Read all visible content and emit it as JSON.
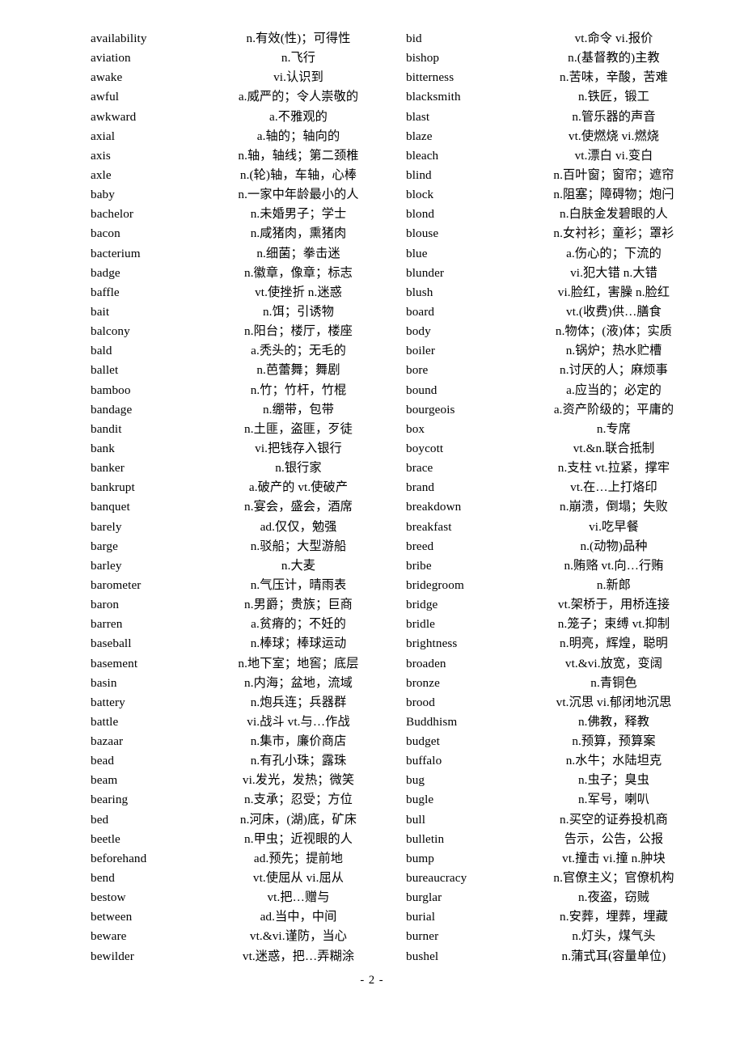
{
  "page": {
    "footer_label": "- 2 -",
    "page_number": "2",
    "text_color": "#000000",
    "background_color": "#ffffff"
  },
  "columns": [
    {
      "name": "left-column",
      "entries": [
        {
          "term": "availability",
          "definition": "n.有效(性)；可得性"
        },
        {
          "term": "aviation",
          "definition": "n.飞行"
        },
        {
          "term": "awake",
          "definition": "vi.认识到"
        },
        {
          "term": "awful",
          "definition": "a.威严的；令人崇敬的"
        },
        {
          "term": "awkward",
          "definition": "a.不雅观的"
        },
        {
          "term": "axial",
          "definition": "a.轴的；轴向的"
        },
        {
          "term": "axis",
          "definition": "n.轴，轴线；第二颈椎"
        },
        {
          "term": "axle",
          "definition": "n.(轮)轴，车轴，心棒"
        },
        {
          "term": "baby",
          "definition": "n.一家中年龄最小的人"
        },
        {
          "term": "bachelor",
          "definition": "n.未婚男子；学士"
        },
        {
          "term": "bacon",
          "definition": "n.咸猪肉，熏猪肉"
        },
        {
          "term": "bacterium",
          "definition": "n.细菌；拳击迷"
        },
        {
          "term": "badge",
          "definition": "n.徽章，像章；标志"
        },
        {
          "term": "baffle",
          "definition": "vt.使挫折 n.迷惑"
        },
        {
          "term": "bait",
          "definition": "n.饵；引诱物"
        },
        {
          "term": "balcony",
          "definition": "n.阳台；楼厅，楼座"
        },
        {
          "term": "bald",
          "definition": "a.秃头的；无毛的"
        },
        {
          "term": "ballet",
          "definition": "n.芭蕾舞；舞剧"
        },
        {
          "term": "bamboo",
          "definition": "n.竹；竹杆，竹棍"
        },
        {
          "term": "bandage",
          "definition": "n.绷带，包带"
        },
        {
          "term": "bandit",
          "definition": "n.土匪，盗匪，歹徒"
        },
        {
          "term": "bank",
          "definition": "vi.把钱存入银行"
        },
        {
          "term": "banker",
          "definition": "n.银行家"
        },
        {
          "term": "bankrupt",
          "definition": "a.破产的 vt.使破产"
        },
        {
          "term": "banquet",
          "definition": "n.宴会，盛会，酒席"
        },
        {
          "term": "barely",
          "definition": "ad.仅仅，勉强"
        },
        {
          "term": "barge",
          "definition": "n.驳船；大型游船"
        },
        {
          "term": "barley",
          "definition": "n.大麦"
        },
        {
          "term": "barometer",
          "definition": "n.气压计，晴雨表"
        },
        {
          "term": "baron",
          "definition": "n.男爵；贵族；巨商"
        },
        {
          "term": "barren",
          "definition": "a.贫瘠的；不妊的"
        },
        {
          "term": "baseball",
          "definition": "n.棒球；棒球运动"
        },
        {
          "term": "basement",
          "definition": "n.地下室；地窖；底层"
        },
        {
          "term": "basin",
          "definition": "n.内海；盆地，流域"
        },
        {
          "term": "battery",
          "definition": "n.炮兵连；兵器群"
        },
        {
          "term": "battle",
          "definition": "vi.战斗 vt.与…作战"
        },
        {
          "term": "bazaar",
          "definition": "n.集市，廉价商店"
        },
        {
          "term": "bead",
          "definition": "n.有孔小珠；露珠"
        },
        {
          "term": "beam",
          "definition": "vi.发光，发热；微笑"
        },
        {
          "term": "bearing",
          "definition": "n.支承；忍受；方位"
        },
        {
          "term": "bed",
          "definition": "n.河床，(湖)底，矿床"
        },
        {
          "term": "beetle",
          "definition": "n.甲虫；近视眼的人"
        },
        {
          "term": "beforehand",
          "definition": "ad.预先；提前地"
        },
        {
          "term": "bend",
          "definition": "vt.使屈从 vi.屈从"
        },
        {
          "term": "bestow",
          "definition": "vt.把…赠与"
        },
        {
          "term": "between",
          "definition": "ad.当中，中间"
        },
        {
          "term": "beware",
          "definition": "vt.&vi.谨防，当心"
        },
        {
          "term": "bewilder",
          "definition": "vt.迷惑，把…弄糊涂"
        }
      ]
    },
    {
      "name": "right-column",
      "entries": [
        {
          "term": "bid",
          "definition": "vt.命令 vi.报价"
        },
        {
          "term": "bishop",
          "definition": "n.(基督教的)主教"
        },
        {
          "term": "bitterness",
          "definition": "n.苦味，辛酸，苦难"
        },
        {
          "term": "blacksmith",
          "definition": "n.铁匠，锻工"
        },
        {
          "term": "blast",
          "definition": "n.管乐器的声音"
        },
        {
          "term": "blaze",
          "definition": "vt.使燃烧 vi.燃烧"
        },
        {
          "term": "bleach",
          "definition": "vt.漂白 vi.变白"
        },
        {
          "term": "blind",
          "definition": "n.百叶窗；窗帘；遮帘"
        },
        {
          "term": "block",
          "definition": "n.阻塞；障碍物；炮闩"
        },
        {
          "term": "blond",
          "definition": "n.白肤金发碧眼的人"
        },
        {
          "term": "blouse",
          "definition": "n.女衬衫；童衫；罩衫"
        },
        {
          "term": "blue",
          "definition": "a.伤心的；下流的"
        },
        {
          "term": "blunder",
          "definition": "vi.犯大错 n.大错"
        },
        {
          "term": "blush",
          "definition": "vi.脸红，害臊 n.脸红"
        },
        {
          "term": "board",
          "definition": "vt.(收费)供…膳食"
        },
        {
          "term": "body",
          "definition": "n.物体；(液)体；实质"
        },
        {
          "term": "boiler",
          "definition": "n.锅炉；热水贮槽"
        },
        {
          "term": "bore",
          "definition": "n.讨厌的人；麻烦事"
        },
        {
          "term": "bound",
          "definition": "a.应当的；必定的"
        },
        {
          "term": "bourgeois",
          "definition": "a.资产阶级的；平庸的"
        },
        {
          "term": "box",
          "definition": "n.专席"
        },
        {
          "term": "boycott",
          "definition": "vt.&n.联合抵制"
        },
        {
          "term": "brace",
          "definition": "n.支柱 vt.拉紧，撑牢"
        },
        {
          "term": "brand",
          "definition": "vt.在…上打烙印"
        },
        {
          "term": "breakdown",
          "definition": "n.崩溃，倒塌；失败"
        },
        {
          "term": "breakfast",
          "definition": "vi.吃早餐"
        },
        {
          "term": "breed",
          "definition": "n.(动物)品种"
        },
        {
          "term": "bribe",
          "definition": "n.贿赂 vt.向…行贿"
        },
        {
          "term": "bridegroom",
          "definition": "n.新郎"
        },
        {
          "term": "bridge",
          "definition": "vt.架桥于，用桥连接"
        },
        {
          "term": "bridle",
          "definition": "n.笼子；束缚 vt.抑制"
        },
        {
          "term": "brightness",
          "definition": "n.明亮，辉煌，聪明"
        },
        {
          "term": "broaden",
          "definition": "vt.&vi.放宽，变阔"
        },
        {
          "term": "bronze",
          "definition": "n.青铜色"
        },
        {
          "term": "brood",
          "definition": "vt.沉思 vi.郁闭地沉思"
        },
        {
          "term": "Buddhism",
          "definition": "n.佛教，释教"
        },
        {
          "term": "budget",
          "definition": "n.预算，预算案"
        },
        {
          "term": "buffalo",
          "definition": "n.水牛；水陆坦克"
        },
        {
          "term": "bug",
          "definition": "n.虫子；臭虫"
        },
        {
          "term": "bugle",
          "definition": "n.军号，喇叭"
        },
        {
          "term": "bull",
          "definition": "n.买空的证券投机商"
        },
        {
          "term": "bulletin",
          "definition": "告示，公告，公报"
        },
        {
          "term": "bump",
          "definition": "vt.撞击 vi.撞 n.肿块"
        },
        {
          "term": "bureaucracy",
          "definition": "n.官僚主义；官僚机构"
        },
        {
          "term": "burglar",
          "definition": "n.夜盗，窃贼"
        },
        {
          "term": "burial",
          "definition": "n.安葬，埋葬，埋藏"
        },
        {
          "term": "burner",
          "definition": "n.灯头，煤气头"
        },
        {
          "term": "bushel",
          "definition": "n.蒲式耳(容量单位)"
        }
      ]
    }
  ]
}
